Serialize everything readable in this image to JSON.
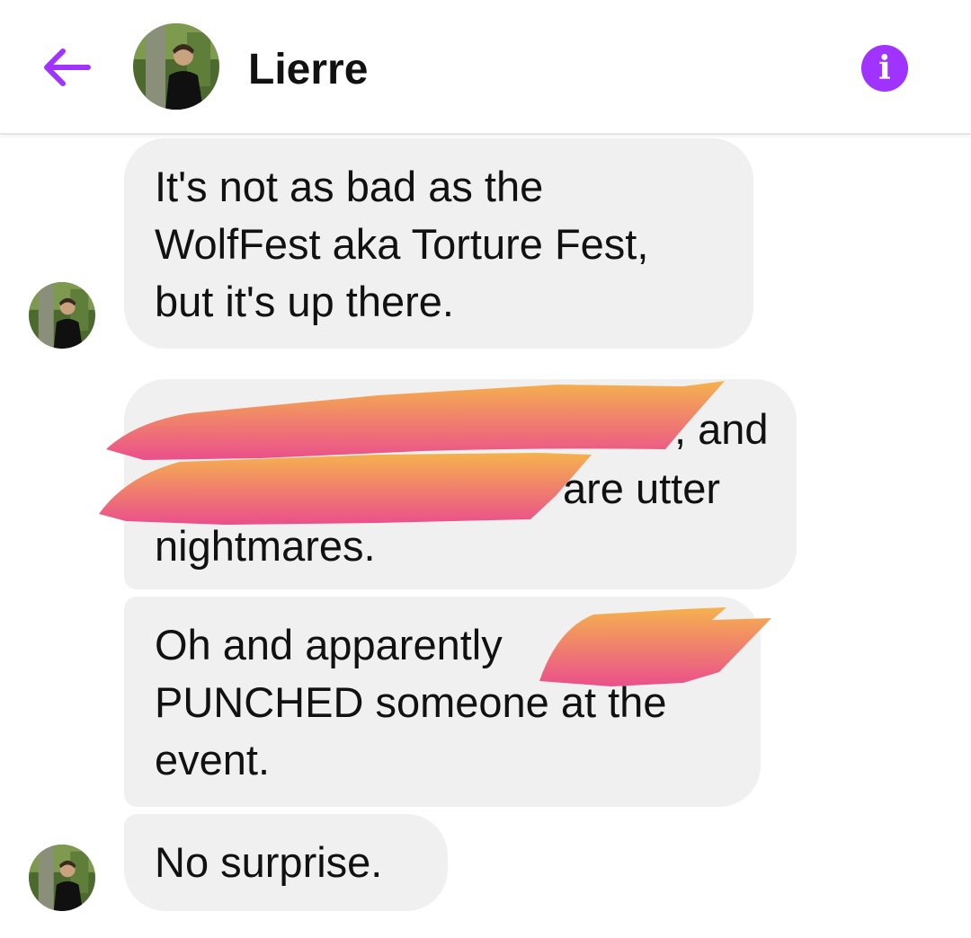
{
  "header": {
    "back_icon": "arrow-left-icon",
    "contact_name": "Lierre",
    "info_icon": "info-icon",
    "accent_color": "#a033ff"
  },
  "messages": [
    {
      "text": "It's not as bad as the\nWolfFest aka Torture Fest,\nbut it's up there."
    },
    {
      "visible_fragments": [
        ", and",
        "are utter",
        "nightmares."
      ]
    },
    {
      "text": "Oh and apparently\nPUNCHED someone at the\nevent."
    },
    {
      "text": "No surprise."
    }
  ],
  "colors": {
    "bubble": "#f0f0f0",
    "redaction_start": "#f5b24d",
    "redaction_end": "#ea4f8c"
  }
}
